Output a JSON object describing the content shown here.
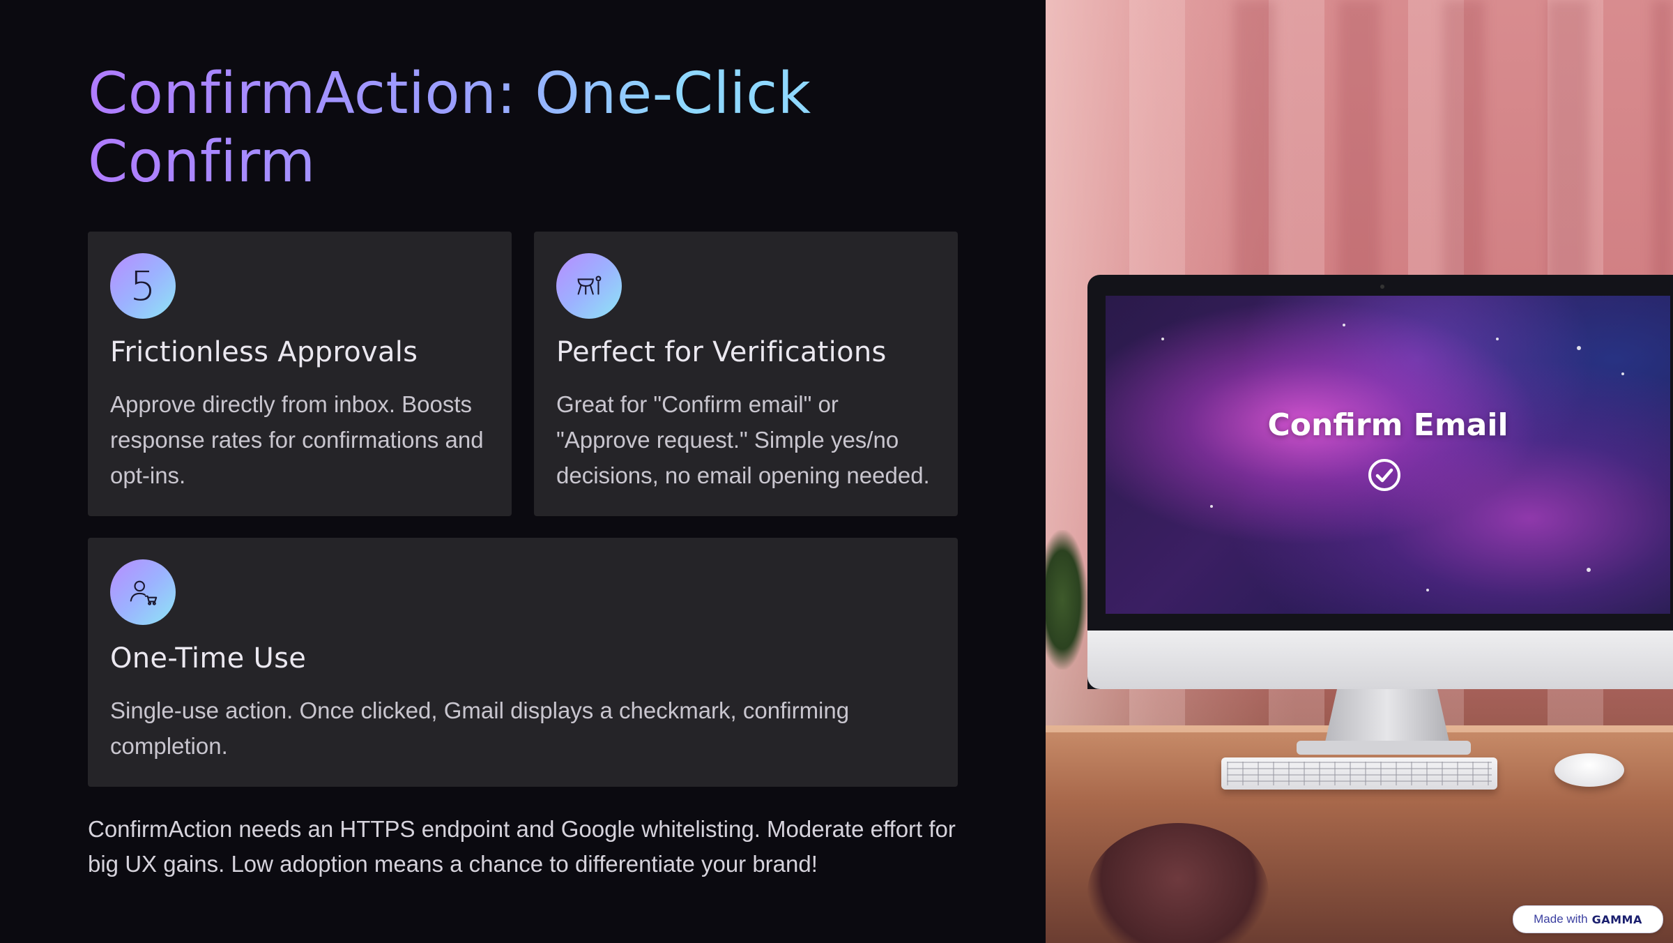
{
  "slide": {
    "title": "ConfirmAction: One-Click Confirm",
    "cards": [
      {
        "icon": "number-five-icon",
        "icon_glyph": "5",
        "title": "Frictionless Approvals",
        "body": "Approve directly from inbox. Boosts response rates for confirmations and opt-ins."
      },
      {
        "icon": "grill-utensils-icon",
        "title": "Perfect for Verifications",
        "body": "Great for \"Confirm email\" or \"Approve request.\" Simple yes/no decisions, no email opening needed."
      },
      {
        "icon": "user-cart-icon",
        "title": "One-Time Use",
        "body": "Single-use action. Once clicked, Gmail displays a checkmark, confirming completion."
      }
    ],
    "footer": "ConfirmAction needs an HTTPS endpoint and Google whitelisting. Moderate effort for big UX gains. Low adoption means a chance to differentiate your brand!"
  },
  "image": {
    "screen_text": "Confirm Email",
    "screen_icon": "check-circle-icon"
  },
  "badge": {
    "prefix": "Made with",
    "brand": "GAMMA"
  },
  "colors": {
    "background": "#0b0a10",
    "card": "#252428",
    "title_gradient_start": "#b07cff",
    "title_gradient_end": "#8fd8ff",
    "icon_gradient_start": "#b78cff",
    "icon_gradient_end": "#8ee6f5"
  }
}
